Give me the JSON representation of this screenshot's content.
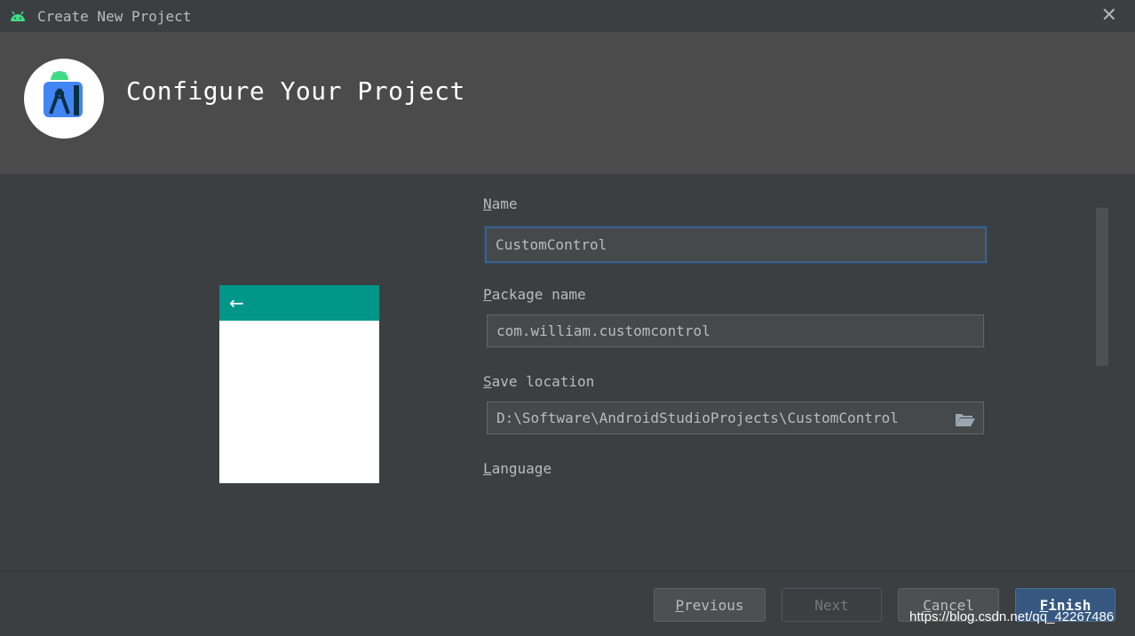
{
  "window": {
    "title": "Create New Project",
    "close_symbol": "✕",
    "icons": {
      "app": "android-icon",
      "close": "close-icon"
    }
  },
  "header": {
    "title": "Configure Your Project",
    "logo": "android-studio-logo"
  },
  "preview": {
    "back_symbol": "←",
    "appbar_color": "#009688"
  },
  "form": {
    "name": {
      "label_first": "N",
      "label_rest": "ame",
      "value": "CustomControl"
    },
    "package": {
      "label_first": "P",
      "label_rest": "ackage name",
      "value": "com.william.customcontrol"
    },
    "save_location": {
      "label_first": "S",
      "label_rest": "ave location",
      "value": "D:\\Software\\AndroidStudioProjects\\CustomControl",
      "icon": "folder-open-icon"
    },
    "language": {
      "label_first": "L",
      "label_rest": "anguage"
    }
  },
  "footer": {
    "previous": {
      "first": "P",
      "rest": "revious"
    },
    "next": "Next",
    "cancel": {
      "first": "C",
      "rest": "ancel"
    },
    "finish": {
      "first": "F",
      "rest": "inish"
    }
  },
  "watermark": "https://blog.csdn.net/qq_42267486",
  "colors": {
    "background": "#3c3f41",
    "header": "#4b4b4b",
    "primary_button": "#365880",
    "focus_border": "#3d6185"
  }
}
